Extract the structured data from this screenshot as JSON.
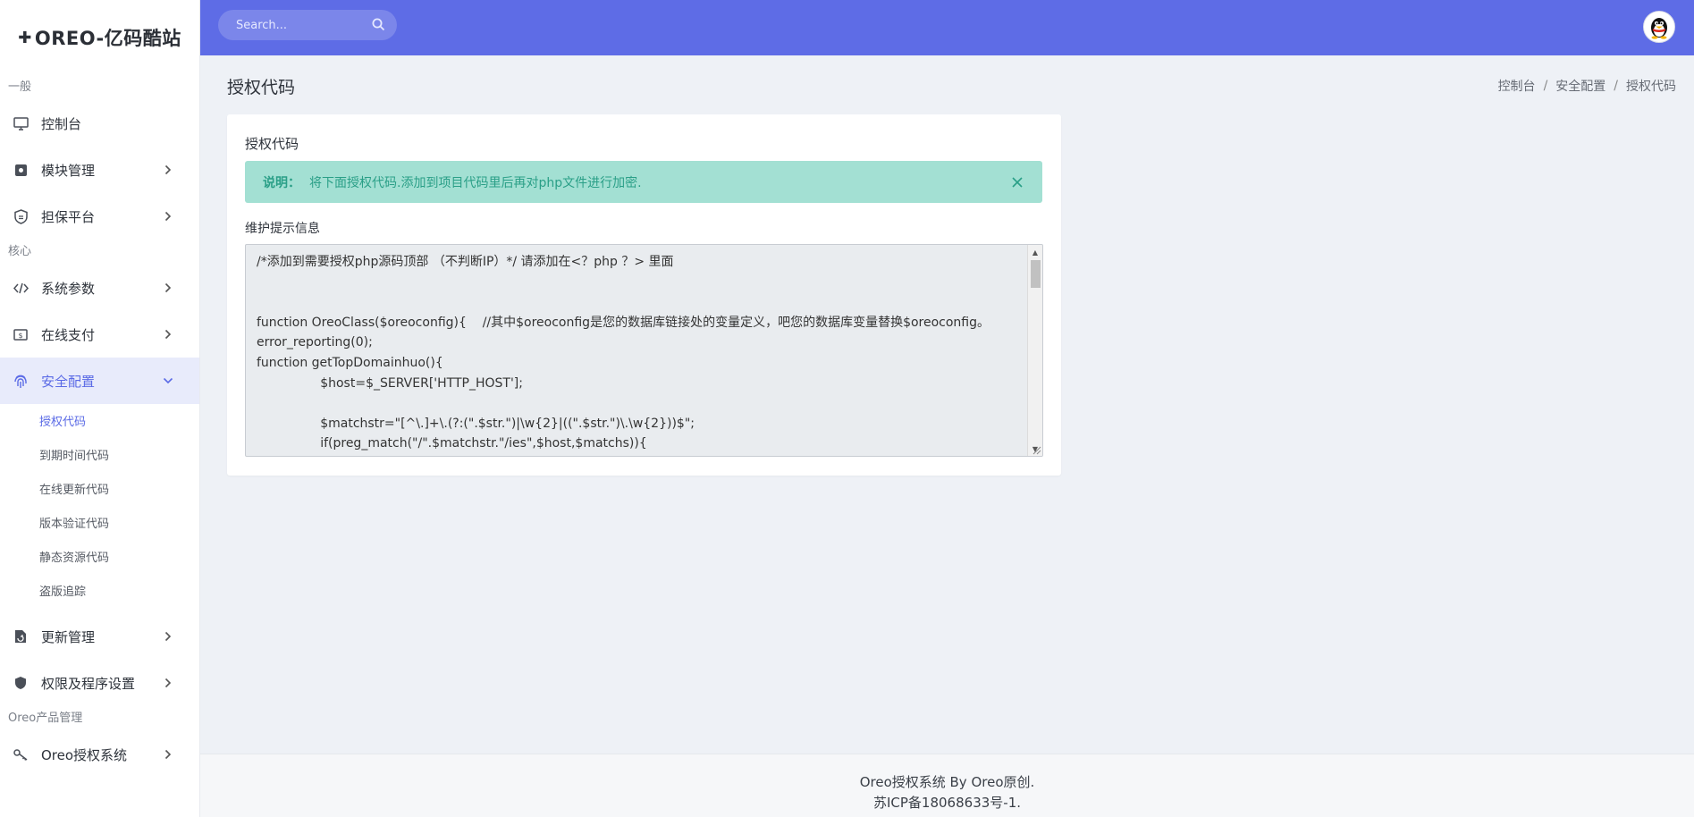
{
  "brand": {
    "logo_glyph": "✚",
    "title": "OREO-亿码酷站"
  },
  "sidebar": {
    "sections": [
      {
        "title": "一般"
      },
      {
        "title": "核心"
      },
      {
        "title": "Oreo产品管理"
      }
    ],
    "items": [
      {
        "label": "控制台",
        "icon": "monitor-icon"
      },
      {
        "label": "模块管理",
        "icon": "module-icon"
      },
      {
        "label": "担保平台",
        "icon": "shield-badge-icon"
      },
      {
        "label": "系统参数",
        "icon": "code-icon"
      },
      {
        "label": "在线支付",
        "icon": "cash-icon"
      },
      {
        "label": "安全配置",
        "icon": "fingerprint-icon"
      },
      {
        "label": "更新管理",
        "icon": "file-update-icon"
      },
      {
        "label": "权限及程序设置",
        "icon": "shield-icon"
      },
      {
        "label": "Oreo授权系统",
        "icon": "key-icon"
      }
    ],
    "security_sub": [
      {
        "label": "授权代码"
      },
      {
        "label": "到期时间代码"
      },
      {
        "label": "在线更新代码"
      },
      {
        "label": "版本验证代码"
      },
      {
        "label": "静态资源代码"
      },
      {
        "label": "盗版追踪"
      }
    ]
  },
  "topbar": {
    "search_placeholder": "Search..."
  },
  "page": {
    "title": "授权代码",
    "breadcrumb": [
      "控制台",
      "安全配置",
      "授权代码"
    ]
  },
  "card": {
    "title": "授权代码",
    "alert_prefix": "说明：",
    "alert_text": "将下面授权代码.添加到项目代码里后再对php文件进行加密.",
    "field_label": "维护提示信息",
    "code": "/*添加到需要授权php源码顶部 （不判断IP）*/ 请添加在<？php ？> 里面\n\n\nfunction OreoClass($oreoconfig){    //其中$oreoconfig是您的数据库链接处的变量定义，吧您的数据库变量替换$oreoconfig。\nerror_reporting(0);\nfunction getTopDomainhuo(){\n\t\t$host=$_SERVER['HTTP_HOST'];\n\n\t\t$matchstr=\"[^\\.]+\\.(?:(\".$str.\")|\\w{2}|((\".$str.\")\\.\\w{2}))$\";\n\t\tif(preg_match(\"/\".$matchstr.\"/ies\",$host,$matchs)){"
  },
  "footer": {
    "line1": "Oreo授权系统 By Oreo原创.",
    "line2": "苏ICP备18068633号-1."
  },
  "colors": {
    "topbar": "#5e6ce6",
    "accent": "#5b6be6",
    "alert_bg": "#a3e0d3",
    "alert_text": "#2a9f87"
  }
}
